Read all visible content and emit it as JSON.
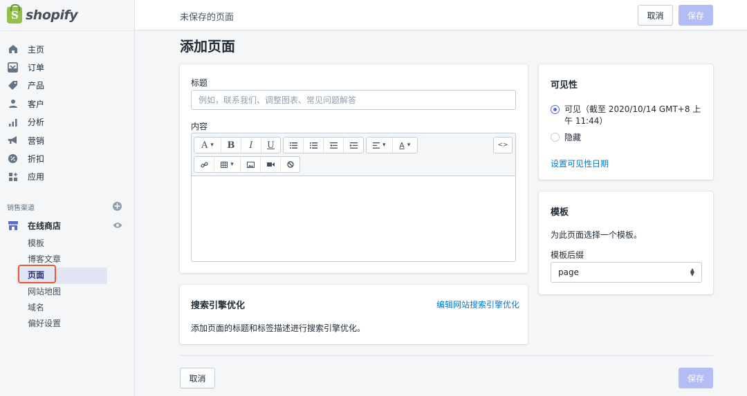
{
  "brand": {
    "logo_text": "shopify",
    "logo_glyph": "S"
  },
  "sidebar": {
    "items": [
      {
        "label": "主页",
        "icon": "home-icon"
      },
      {
        "label": "订单",
        "icon": "orders-icon"
      },
      {
        "label": "产品",
        "icon": "tag-icon"
      },
      {
        "label": "客户",
        "icon": "person-icon"
      },
      {
        "label": "分析",
        "icon": "bar-chart-icon"
      },
      {
        "label": "营销",
        "icon": "megaphone-icon"
      },
      {
        "label": "折扣",
        "icon": "discount-icon"
      },
      {
        "label": "应用",
        "icon": "apps-icon"
      }
    ],
    "sales_channels_title": "销售渠道",
    "add_glyph": "+",
    "online_store_label": "在线商店",
    "sub_items": [
      "模板",
      "博客文章",
      "页面",
      "网站地图",
      "域名",
      "偏好设置"
    ],
    "active_sub_item": "页面"
  },
  "topbar": {
    "title": "未保存的页面",
    "cancel_label": "取消",
    "save_label": "保存"
  },
  "page": {
    "title": "添加页面"
  },
  "form": {
    "title_label": "标题",
    "title_placeholder": "例如，联系我们、调整图表、常见问题解答",
    "content_label": "内容",
    "toolbar": {
      "font_glyph": "A",
      "bold_glyph": "B",
      "italic_glyph": "I",
      "underline_glyph": "U",
      "dropdown_glyph": "▾",
      "code_glyph": "<>"
    }
  },
  "seo": {
    "title": "搜索引擎优化",
    "edit_link": "编辑网站搜索引擎优化",
    "description": "添加页面的标题和标签描述进行搜索引擎优化。"
  },
  "visibility": {
    "title": "可见性",
    "visible_label": "可见（截至 2020/10/14 GMT+8 上午 11:44）",
    "hidden_label": "隐藏",
    "set_date_link": "设置可见性日期"
  },
  "template": {
    "title": "模板",
    "description": "为此页面选择一个模板。",
    "suffix_label": "模板后缀",
    "suffix_value": "page"
  },
  "footer": {
    "cancel_label": "取消",
    "save_label": "保存"
  },
  "colors": {
    "primary_disabled": "#b3bcf5",
    "link": "#007ace",
    "active_nav_bg": "#e4e5f4",
    "highlight": "#e8572f"
  }
}
